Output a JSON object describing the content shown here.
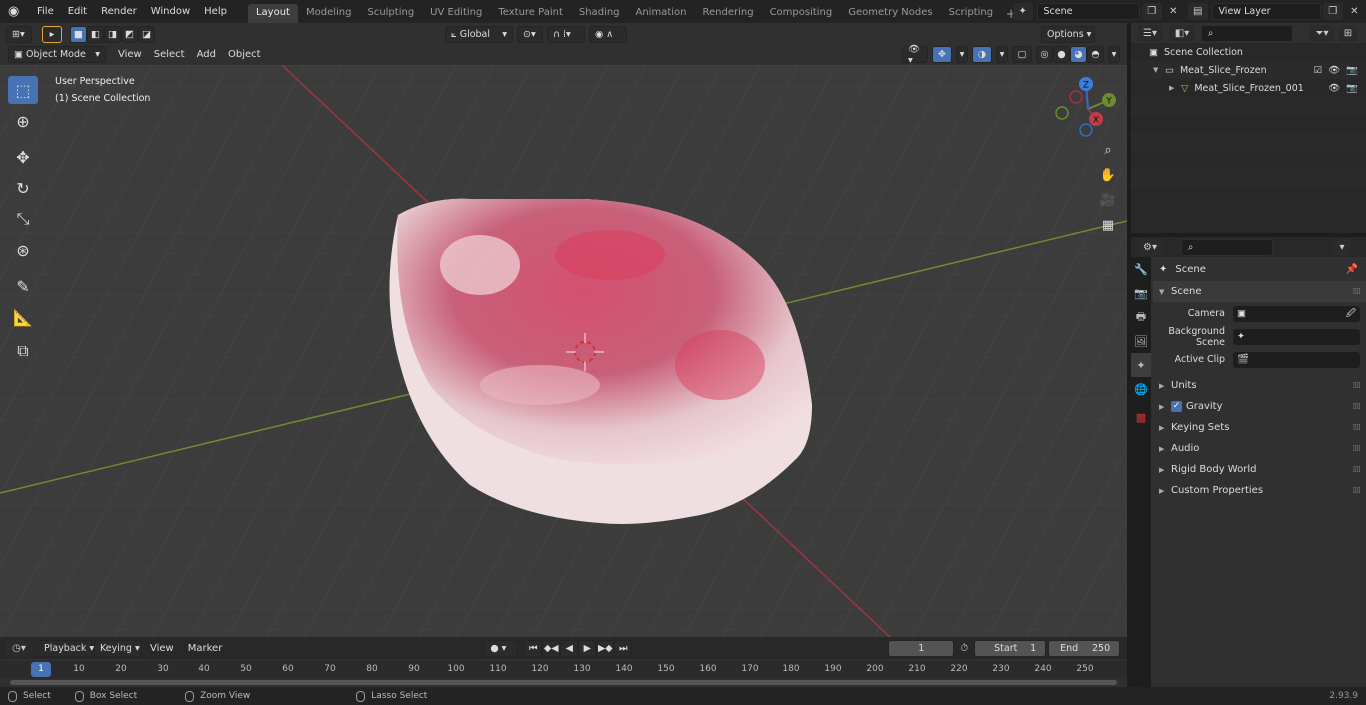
{
  "menu": {
    "items": [
      "File",
      "Edit",
      "Render",
      "Window",
      "Help"
    ]
  },
  "workspaces": [
    "Layout",
    "Modeling",
    "Sculpting",
    "UV Editing",
    "Texture Paint",
    "Shading",
    "Animation",
    "Rendering",
    "Compositing",
    "Geometry Nodes",
    "Scripting"
  ],
  "scene_field": {
    "value": "Scene"
  },
  "view_layer_field": {
    "value": "View Layer"
  },
  "viewport": {
    "mode": "Object Mode",
    "menus": [
      "View",
      "Select",
      "Add",
      "Object"
    ],
    "transform_orientation": "Global",
    "options_label": "Options",
    "overlay_line1": "User Perspective",
    "overlay_line2": "(1) Scene Collection",
    "axes": {
      "x": "X",
      "y": "Y",
      "z": "Z"
    }
  },
  "outliner": {
    "root": "Scene Collection",
    "collection": "Meat_Slice_Frozen",
    "object": "Meat_Slice_Frozen_001"
  },
  "properties": {
    "context": "Scene",
    "section": "Scene",
    "fields": [
      {
        "label": "Camera",
        "value": ""
      },
      {
        "label": "Background Scene",
        "value": ""
      },
      {
        "label": "Active Clip",
        "value": ""
      }
    ],
    "panels": [
      "Units",
      "Gravity",
      "Keying Sets",
      "Audio",
      "Rigid Body World",
      "Custom Properties"
    ]
  },
  "timeline": {
    "menus": [
      "Playback",
      "Keying",
      "View",
      "Marker"
    ],
    "current_frame": "1",
    "start_label": "Start",
    "start_value": "1",
    "end_label": "End",
    "end_value": "250",
    "ruler": [
      "1",
      "10",
      "20",
      "30",
      "40",
      "50",
      "60",
      "70",
      "80",
      "90",
      "100",
      "110",
      "120",
      "130",
      "140",
      "150",
      "160",
      "170",
      "180",
      "190",
      "200",
      "210",
      "220",
      "230",
      "240",
      "250"
    ]
  },
  "statusbar": {
    "select": "Select",
    "box_select": "Box Select",
    "zoom_view": "Zoom View",
    "lasso_select": "Lasso Select",
    "version": "2.93.9"
  },
  "colors": {
    "accent": "#4772b3",
    "x_axis": "#a3343e",
    "y_axis": "#6d8b2f",
    "meat": "#d35a7f"
  }
}
